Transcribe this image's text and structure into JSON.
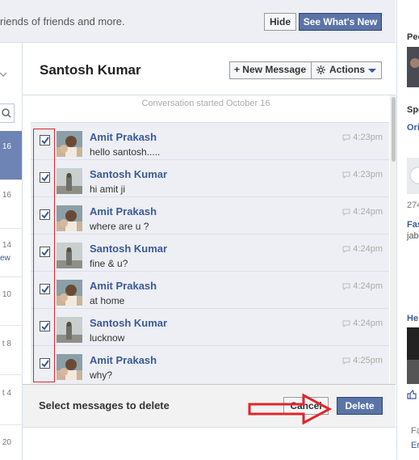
{
  "banner": {
    "text": "riends of friends and more.",
    "hide_label": "Hide",
    "see_label": "See What's New"
  },
  "left_list": {
    "dates": [
      "16",
      "16",
      "14",
      "10",
      "t 8",
      "t 4",
      "20"
    ],
    "link": "ew"
  },
  "header": {
    "title": "Santosh Kumar",
    "new_message": "+ New Message",
    "actions": "Actions"
  },
  "conversation": {
    "started": "Conversation started October 16",
    "messages": [
      {
        "sender": "Amit Prakash",
        "text": "hello santosh.....",
        "time": "4:23pm",
        "checked": true
      },
      {
        "sender": "Santosh Kumar",
        "text": "hi amit ji",
        "time": "4:23pm",
        "checked": true
      },
      {
        "sender": "Amit Prakash",
        "text": "where are u ?",
        "time": "4:24pm",
        "checked": true
      },
      {
        "sender": "Santosh Kumar",
        "text": "fine & u?",
        "time": "4:24pm",
        "checked": true
      },
      {
        "sender": "Amit Prakash",
        "text": "at home",
        "time": "4:24pm",
        "checked": true
      },
      {
        "sender": "Santosh Kumar",
        "text": "lucknow",
        "time": "4:24pm",
        "checked": true
      },
      {
        "sender": "Amit Prakash",
        "text": "why?",
        "time": "4:25pm",
        "checked": true
      }
    ]
  },
  "footer": {
    "label": "Select messages to delete",
    "cancel": "Cancel",
    "delete": "Delete"
  },
  "right_col": {
    "t1": "Peo",
    "t2": "Spo",
    "t3": "Ori",
    "t4": "274",
    "t5": "Fas",
    "t6": "jab",
    "t7": "He",
    "t8": "Fa",
    "t9": "Er"
  },
  "colors": {
    "accent": "#3b5998",
    "button_blue": "#5b74a8",
    "annotation_red": "#e0252b"
  }
}
